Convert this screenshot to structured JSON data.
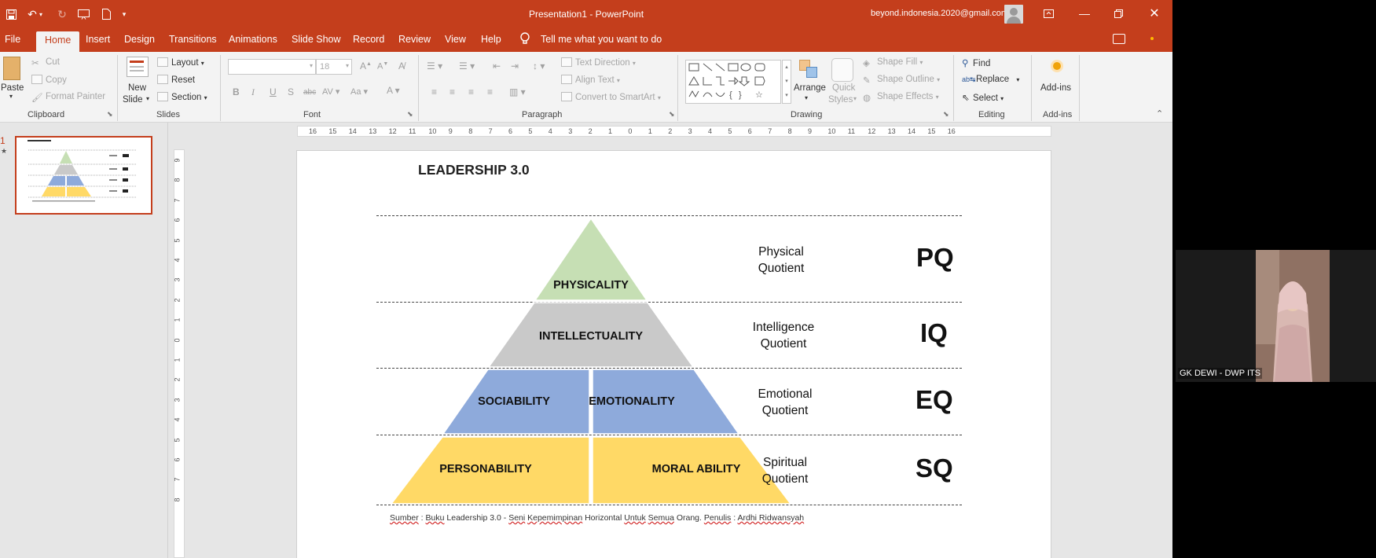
{
  "titlebar": {
    "title": "Presentation1  -  PowerPoint",
    "account": "beyond.indonesia.2020@gmail.com"
  },
  "tabs": [
    "File",
    "Home",
    "Insert",
    "Design",
    "Transitions",
    "Animations",
    "Slide Show",
    "Record",
    "Review",
    "View",
    "Help"
  ],
  "tell_me": "Tell me what you want to do",
  "ribbon": {
    "clipboard": {
      "paste": "Paste",
      "cut": "Cut",
      "copy": "Copy",
      "format_painter": "Format Painter",
      "label": "Clipboard"
    },
    "slides": {
      "new_slide_1": "New",
      "new_slide_2": "Slide",
      "layout": "Layout",
      "reset": "Reset",
      "section": "Section",
      "label": "Slides"
    },
    "font": {
      "size": "18",
      "label": "Font"
    },
    "paragraph": {
      "text_direction": "Text Direction",
      "align_text": "Align Text",
      "convert": "Convert to SmartArt",
      "label": "Paragraph"
    },
    "drawing": {
      "arrange": "Arrange",
      "quick_1": "Quick",
      "quick_2": "Styles",
      "fill": "Shape Fill",
      "outline": "Shape Outline",
      "effects": "Shape Effects",
      "label": "Drawing"
    },
    "editing": {
      "find": "Find",
      "replace": "Replace",
      "select": "Select",
      "label": "Editing"
    },
    "addins": {
      "button": "Add-ins",
      "label": "Add-ins"
    }
  },
  "slide_panel": {
    "number": "1"
  },
  "ruler": {
    "h": [
      "16",
      "15",
      "14",
      "13",
      "12",
      "11",
      "10",
      "9",
      "8",
      "7",
      "6",
      "5",
      "4",
      "3",
      "2",
      "1",
      "0",
      "1",
      "2",
      "3",
      "4",
      "5",
      "6",
      "7",
      "8",
      "9",
      "10",
      "11",
      "12",
      "13",
      "14",
      "15",
      "16"
    ],
    "v": [
      "9",
      "8",
      "7",
      "6",
      "5",
      "4",
      "3",
      "2",
      "1",
      "0",
      "1",
      "2",
      "3",
      "4",
      "5",
      "6",
      "7",
      "8"
    ]
  },
  "slide": {
    "title": "LEADERSHIP 3.0",
    "levels": {
      "physicality": "PHYSICALITY",
      "intellectuality": "INTELLECTUALITY",
      "sociability": "SOCIABILITY",
      "emotionality": "EMOTIONALITY",
      "personability": "PERSONABILITY",
      "moral_ability": "MORAL ABILITY"
    },
    "quotients": [
      {
        "line1": "Physical",
        "line2": "Quotient",
        "code": "PQ"
      },
      {
        "line1": "Intelligence",
        "line2": "Quotient",
        "code": "IQ"
      },
      {
        "line1": "Emotional",
        "line2": "Quotient",
        "code": "EQ"
      },
      {
        "line1": "Spiritual",
        "line2": "Quotient",
        "code": "SQ"
      }
    ],
    "source": {
      "p1": "Sumber",
      "p2": " : ",
      "p3": "Buku",
      "p4": " Leadership 3.0 - ",
      "p5": "Seni",
      "p6": " ",
      "p7": "Kepemimpinan",
      "p8": " Horizontal ",
      "p9": "Untuk",
      "p10": " ",
      "p11": "Semua",
      "p12": " Orang. ",
      "p13": "Penulis",
      "p14": " : ",
      "p15": "Ardhi Ridwansyah"
    },
    "colors": {
      "green": "#c6dfb4",
      "gray": "#c9c9c9",
      "blue": "#8eaadb",
      "yellow": "#ffd966"
    }
  },
  "video": {
    "caller": "GK DEWI - DWP ITS"
  }
}
